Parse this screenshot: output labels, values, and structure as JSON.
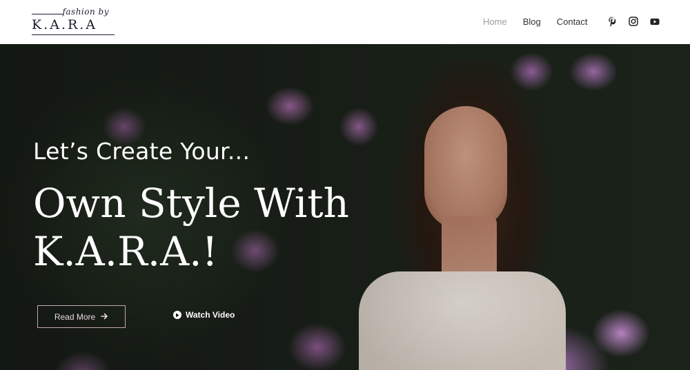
{
  "header": {
    "logo": {
      "script": "fashion by",
      "word": "K.A.R.A"
    },
    "nav": [
      {
        "label": "Home",
        "active": true
      },
      {
        "label": "Blog",
        "active": false
      },
      {
        "label": "Contact",
        "active": false
      }
    ],
    "social": [
      "pinterest-icon",
      "instagram-icon",
      "youtube-icon"
    ]
  },
  "hero": {
    "subtitle": "Let’s Create Your...",
    "title_line1": "Own Style With",
    "title_line2": "K.A.R.A.!",
    "read_more": "Read More",
    "watch_video": "Watch Video"
  },
  "colors": {
    "nav_active": "#a29a9d",
    "nav_text": "#333333",
    "brand_dark": "#1b1b2f",
    "button_border": "#c9a7b0"
  }
}
